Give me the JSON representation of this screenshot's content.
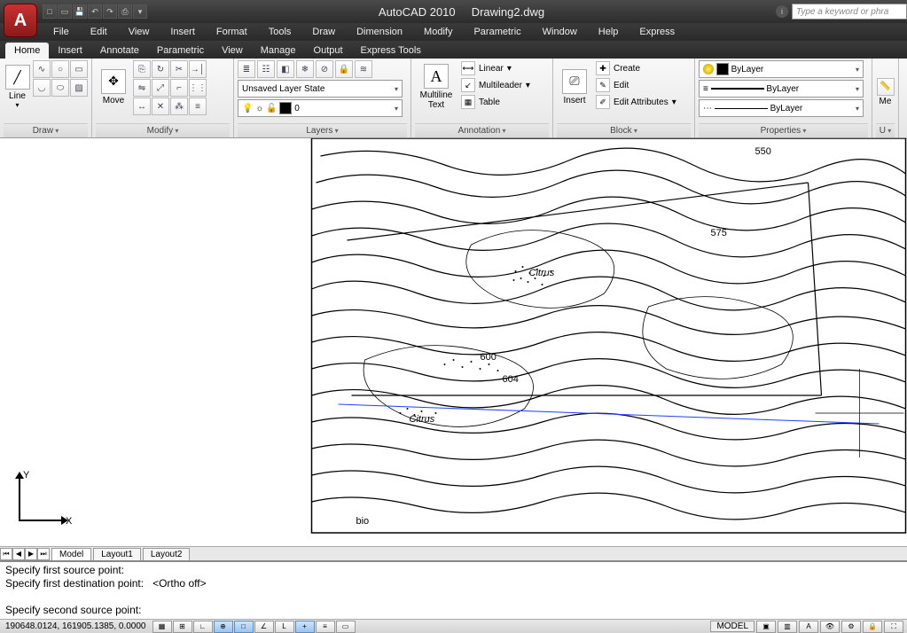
{
  "title": {
    "app": "AutoCAD 2010",
    "doc": "Drawing2.dwg"
  },
  "search": {
    "placeholder": "Type a keyword or phra"
  },
  "menus": [
    "File",
    "Edit",
    "View",
    "Insert",
    "Format",
    "Tools",
    "Draw",
    "Dimension",
    "Modify",
    "Parametric",
    "Window",
    "Help",
    "Express"
  ],
  "ribbon_tabs": [
    "Home",
    "Insert",
    "Annotate",
    "Parametric",
    "View",
    "Manage",
    "Output",
    "Express Tools"
  ],
  "ribbon_active": "Home",
  "panels": {
    "draw": {
      "title": "Draw",
      "line_label": "Line",
      "line_dd": "▾"
    },
    "modify": {
      "title": "Modify",
      "move_label": "Move"
    },
    "layers": {
      "title": "Layers",
      "state_dd": "Unsaved Layer State",
      "current_layer": "0"
    },
    "annotation": {
      "title": "Annotation",
      "mtext_label": "Multiline\nText",
      "linear": "Linear",
      "multileader": "Multileader",
      "table": "Table"
    },
    "block": {
      "title": "Block",
      "insert_label": "Insert",
      "create": "Create",
      "edit": "Edit",
      "editattr": "Edit Attributes"
    },
    "properties": {
      "title": "Properties",
      "color": "ByLayer",
      "lweight": "ByLayer",
      "ltype": "ByLayer"
    },
    "utilities": {
      "title": "U",
      "label": "Me"
    }
  },
  "ucs": {
    "x": "X",
    "y": "Y"
  },
  "layout_tabs": [
    "Model",
    "Layout1",
    "Layout2"
  ],
  "layout_active": "Model",
  "cmd": {
    "l1": "Specify first source point:",
    "l2": "Specify first destination point:   <Ortho off>",
    "l3": "",
    "l4": "Specify second source point:"
  },
  "status": {
    "coords": "190648.0124, 161905.1385, 0.0000",
    "model": "MODEL"
  },
  "map_labels": {
    "a": "550",
    "b": "575",
    "c": "600",
    "d": "604",
    "e": "Citrus",
    "f": "Citrus",
    "g": "bio"
  }
}
